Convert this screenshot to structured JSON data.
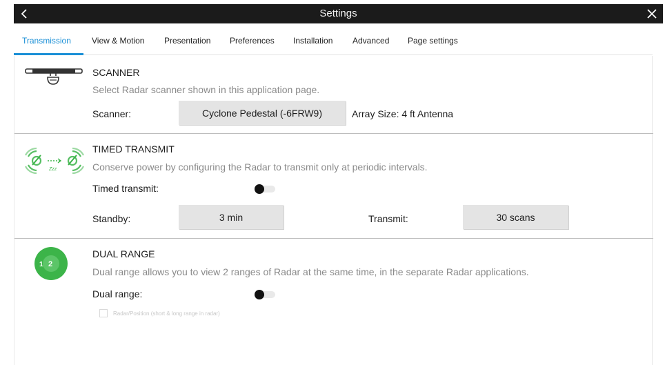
{
  "header": {
    "title": "Settings",
    "back_icon": "chevron-left-icon",
    "close_icon": "close-icon"
  },
  "tabs": [
    {
      "label": "Transmission",
      "active": true
    },
    {
      "label": "View & Motion",
      "active": false
    },
    {
      "label": "Presentation",
      "active": false
    },
    {
      "label": "Preferences",
      "active": false
    },
    {
      "label": "Installation",
      "active": false
    },
    {
      "label": "Advanced",
      "active": false
    },
    {
      "label": "Page settings",
      "active": false
    }
  ],
  "scanner": {
    "icon": "radar-scanner-icon",
    "title": "SCANNER",
    "description": "Select Radar scanner shown in this application page.",
    "scanner_label": "Scanner:",
    "scanner_value": "Cyclone Pedestal (-6FRW9)",
    "array_size": "Array Size: 4 ft Antenna"
  },
  "timed_transmit": {
    "icon": "timed-transmit-icon",
    "title": "TIMED TRANSMIT",
    "description": "Conserve power by configuring the Radar to transmit only at periodic intervals.",
    "toggle_label": "Timed transmit:",
    "toggle_on": false,
    "standby_label": "Standby:",
    "standby_value": "3 min",
    "transmit_label": "Transmit:",
    "transmit_value": "30 scans"
  },
  "dual_range": {
    "icon": "dual-range-icon",
    "title": "DUAL RANGE",
    "description": "Dual range allows you to view 2 ranges of Radar at the same time, in the separate Radar applications.",
    "toggle_label": "Dual range:",
    "toggle_on": false,
    "checkbox_label": "Radar/Position (short & long range in radar)",
    "checkbox_checked": false
  },
  "colors": {
    "accent": "#1a8fd6",
    "titlebar": "#1b1b1b",
    "icon_green": "#3cb449",
    "button_bg": "#e4e4e4"
  }
}
